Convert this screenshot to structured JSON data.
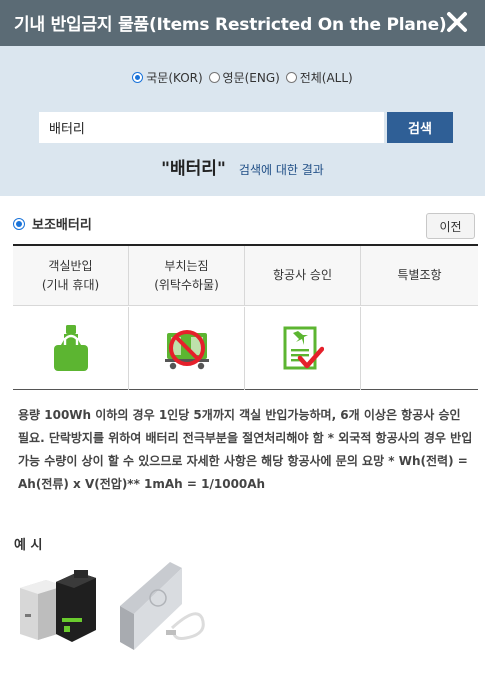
{
  "header": {
    "title": "기내 반입금지 물품(Items Restricted On the Plane)"
  },
  "search": {
    "languages": [
      {
        "label": "국문(KOR)",
        "selected": true
      },
      {
        "label": "영문(ENG)",
        "selected": false
      },
      {
        "label": "전체(ALL)",
        "selected": false
      }
    ],
    "query": "배터리",
    "button_label": "검색",
    "result_term": "\"배터리\"",
    "result_label": "검색에 대한 결과"
  },
  "item": {
    "name": "보조배터리",
    "prev_label": "이전",
    "columns": [
      {
        "line1": "객실반입",
        "line2": "(기내 휴대)"
      },
      {
        "line1": "부치는짐",
        "line2": "(위탁수하물)"
      },
      {
        "line1": "항공사 승인",
        "line2": ""
      },
      {
        "line1": "특별조항",
        "line2": ""
      }
    ],
    "description": "용량 100Wh 이하의 경우 1인당 5개까지 객실 반입가능하며, 6개 이상은 항공사 승인 필요. 단락방지를 위하여 배터리 전극부분을 절연처리해야 함 * 외국적 항공사의 경우 반입 가능 수량이 상이 할 수 있으므로 자세한 사항은 해당 항공사에 문의 요망 * Wh(전력) = Ah(전류) x V(전압)** 1mAh = 1/1000Ah"
  },
  "example": {
    "label": "예 시"
  },
  "colors": {
    "header_bg": "#5b6b75",
    "panel_bg": "#dbe6ef",
    "button_bg": "#2f5f96",
    "allowed_green": "#5cb531",
    "prohibited_red": "#e5202b",
    "approval_red": "#e5202b"
  },
  "icons": {
    "close": "close-icon",
    "cabin": "carry-on-bag-allowed-icon",
    "checked": "checked-baggage-prohibited-icon",
    "approval": "airline-approval-document-icon"
  }
}
